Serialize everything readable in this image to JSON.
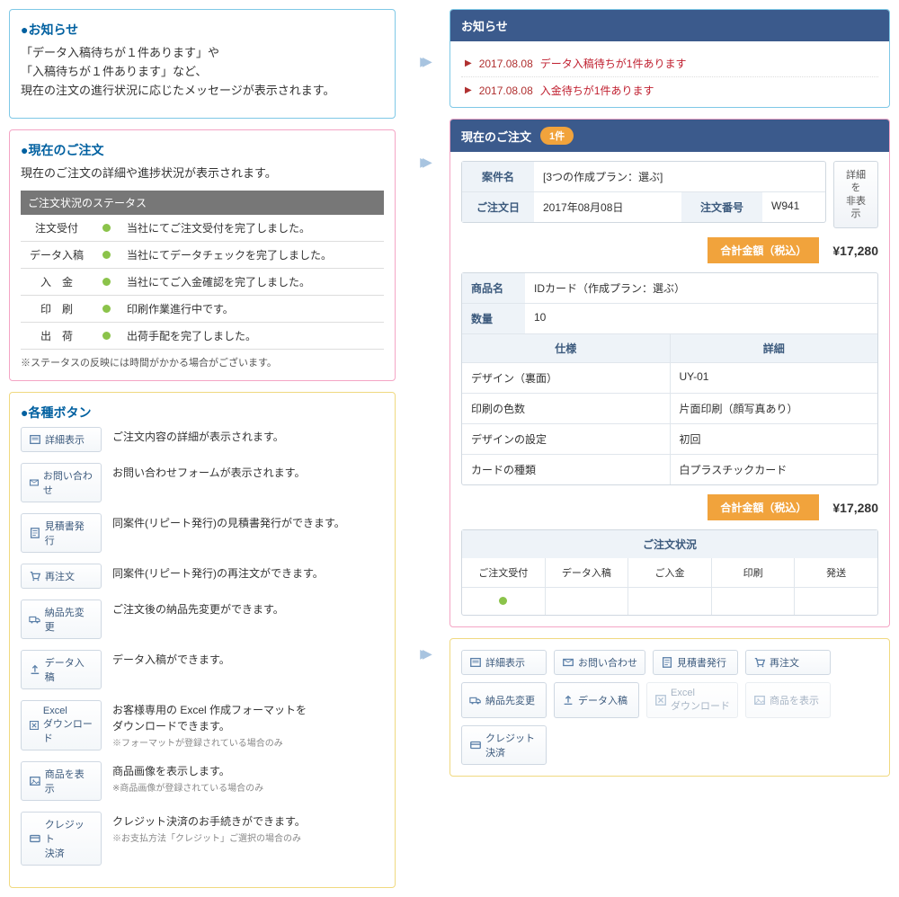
{
  "left": {
    "news": {
      "title": "●お知らせ",
      "line1": "「データ入稿待ちが１件あります」や",
      "line2": "「入稿待ちが１件あります」など、",
      "line3": "現在の注文の進行状況に応じたメッセージが表示されます。"
    },
    "order": {
      "title": "●現在のご注文",
      "text": "現在のご注文の詳細や進捗状況が表示されます。",
      "status_header": "ご注文状況のステータス",
      "statuses": [
        {
          "name": "注文受付",
          "desc": "当社にてご注文受付を完了しました。"
        },
        {
          "name": "データ入稿",
          "desc": "当社にてデータチェックを完了しました。"
        },
        {
          "name": "入　金",
          "desc": "当社にてご入金確認を完了しました。"
        },
        {
          "name": "印　刷",
          "desc": "印刷作業進行中です。"
        },
        {
          "name": "出　荷",
          "desc": "出荷手配を完了しました。"
        }
      ],
      "note": "※ステータスの反映には時間がかかる場合がございます。"
    },
    "buttons": {
      "title": "●各種ボタン",
      "items": [
        {
          "label": "詳細表示",
          "desc": "ご注文内容の詳細が表示されます。",
          "icon": "detail"
        },
        {
          "label": "お問い合わせ",
          "desc": "お問い合わせフォームが表示されます。",
          "icon": "mail"
        },
        {
          "label": "見積書発行",
          "desc": "同案件(リピート発行)の見積書発行ができます。",
          "icon": "doc"
        },
        {
          "label": "再注文",
          "desc": "同案件(リピート発行)の再注文ができます。",
          "icon": "cart"
        },
        {
          "label": "納品先変更",
          "desc": "ご注文後の納品先変更ができます。",
          "icon": "truck"
        },
        {
          "label": "データ入稿",
          "desc": "データ入稿ができます。",
          "icon": "upload"
        },
        {
          "label": "Excel\nダウンロード",
          "desc": "お客様専用の Excel 作成フォーマットを\nダウンロードできます。",
          "note": "※フォーマットが登録されている場合のみ",
          "icon": "excel"
        },
        {
          "label": "商品を表示",
          "desc": "商品画像を表示します。",
          "note": "※商品画像が登録されている場合のみ",
          "icon": "image"
        },
        {
          "label": "クレジット\n決済",
          "desc": "クレジット決済のお手続きができます。",
          "note": "※お支払方法「クレジット」ご選択の場合のみ",
          "icon": "card"
        }
      ]
    }
  },
  "right": {
    "news": {
      "header": "お知らせ",
      "items": [
        {
          "date": "2017.08.08",
          "text": "データ入稿待ちが1件あります"
        },
        {
          "date": "2017.08.08",
          "text": "入金待ちが1件あります"
        }
      ]
    },
    "order": {
      "header": "現在のご注文",
      "count": "1件",
      "case_label": "案件名",
      "case_value": "[3つの作成プラン：選ぶ]",
      "date_label": "ご注文日",
      "date_value": "2017年08月08日",
      "num_label": "注文番号",
      "num_value": "W941",
      "toggle": "詳細を\n非表示",
      "total_label": "合計金額（税込）",
      "total_value": "¥17,280",
      "product_name_label": "商品名",
      "product_name": "IDカード（作成プラン：選ぶ）",
      "qty_label": "数量",
      "qty_value": "10",
      "spec_header1": "仕様",
      "spec_header2": "詳細",
      "specs": [
        {
          "k": "デザイン（裏面）",
          "v": "UY-01"
        },
        {
          "k": "印刷の色数",
          "v": "片面印刷（顔写真あり）"
        },
        {
          "k": "デザインの設定",
          "v": "初回"
        },
        {
          "k": "カードの種類",
          "v": "白プラスチックカード"
        }
      ],
      "status_header": "ご注文状況",
      "status_cols": [
        "ご注文受付",
        "データ入稿",
        "ご入金",
        "印刷",
        "発送"
      ],
      "status_dots": [
        true,
        false,
        false,
        false,
        false
      ]
    },
    "buttons": [
      {
        "label": "詳細表示",
        "icon": "detail",
        "disabled": false
      },
      {
        "label": "お問い合わせ",
        "icon": "mail",
        "disabled": false
      },
      {
        "label": "見積書発行",
        "icon": "doc",
        "disabled": false
      },
      {
        "label": "再注文",
        "icon": "cart",
        "disabled": false
      },
      {
        "label": "納品先変更",
        "icon": "truck",
        "disabled": false
      },
      {
        "label": "データ入稿",
        "icon": "upload",
        "disabled": false
      },
      {
        "label": "Excel\nダウンロード",
        "icon": "excel",
        "disabled": true
      },
      {
        "label": "商品を表示",
        "icon": "image",
        "disabled": true
      },
      {
        "label": "クレジット\n決済",
        "icon": "card",
        "disabled": false
      }
    ]
  }
}
